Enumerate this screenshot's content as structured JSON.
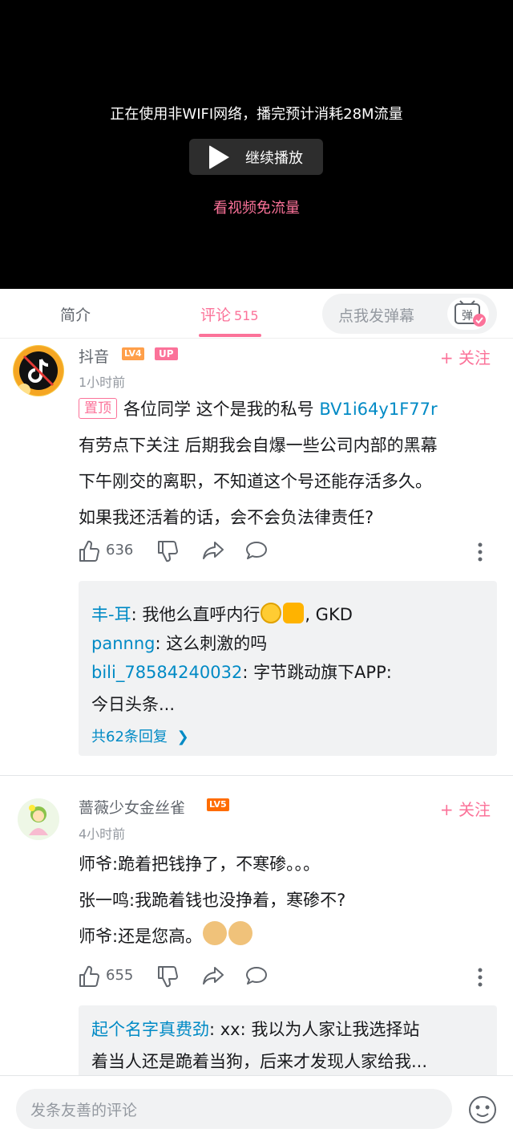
{
  "player": {
    "notice": "正在使用非WIFI网络，播完预计消耗28M流量",
    "continue_label": "继续播放",
    "free_data_label": "看视频免流量"
  },
  "tabs": {
    "intro": "简介",
    "comments": "评论",
    "comment_count": "515",
    "danmaku_placeholder": "点我发弹幕"
  },
  "comments": [
    {
      "user": "抖音",
      "level": "LV4",
      "up_badge": "UP",
      "follow": "+ 关注",
      "time": "1小时前",
      "pinned": "置顶",
      "line1": "各位同学 这个是我的私号 ",
      "link": "BV1i64y1F77r",
      "line2": "有劳点下关注 后期我会自爆一些公司内部的黑幕",
      "line3": "下午刚交的离职，不知道这个号还能存活多久。",
      "line4": "如果我还活着的话，会不会负法律责任?",
      "likes": "636",
      "replies": [
        {
          "name": "丰-耳",
          "text": ": 我他么直呼内行",
          "text_after": ", GKD"
        },
        {
          "name": "pannng",
          "text": ": 这么刺激的吗"
        },
        {
          "name": "bili_78584240032",
          "text": ": 字节跳动旗下APP:"
        },
        {
          "name": "",
          "text": "今日头条..."
        }
      ],
      "more_replies": "共62条回复"
    },
    {
      "user": "蔷薇少女金丝雀",
      "level": "LV5",
      "follow": "+ 关注",
      "time": "4小时前",
      "line1": "师爷:跪着把钱挣了，不寒碜。。。",
      "line2": "张一鸣:我跪着钱也没挣着，寒碜不?",
      "line3": "师爷:还是您高。",
      "likes": "655",
      "replies": [
        {
          "name": "起个名字真费劲",
          "text": ": xx: 我以为人家让我选择站"
        },
        {
          "name": "",
          "text": "着当人还是跪着当狗，后来才发现人家给我..."
        }
      ]
    }
  ],
  "bottom": {
    "placeholder": "发条友善的评论"
  },
  "colors": {
    "accent": "#fb7299",
    "link": "#008ac5",
    "lv4": "#ff9f4a",
    "lv5": "#ff6c00"
  }
}
